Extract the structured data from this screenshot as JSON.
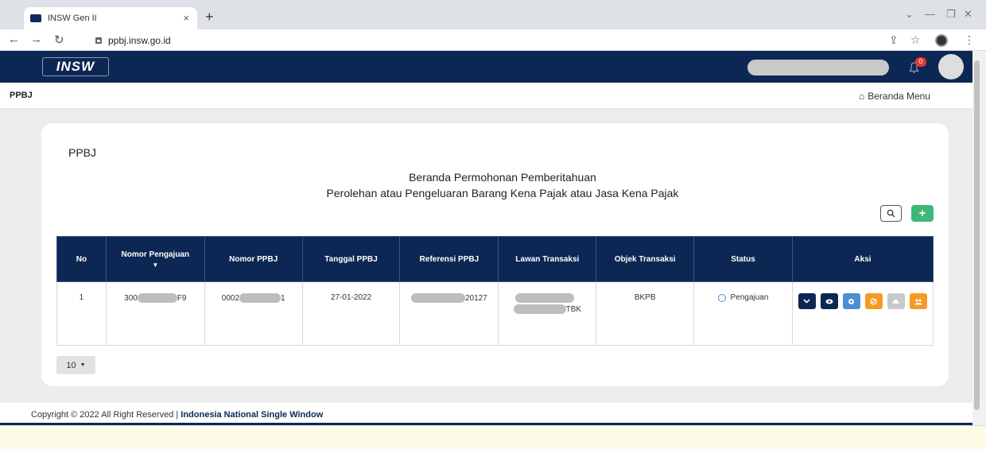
{
  "browser": {
    "tab_title": "INSW Gen II",
    "tab_close": "×",
    "new_tab": "+",
    "url": "ppbj.insw.go.id"
  },
  "header": {
    "logo_text": "INSW",
    "notification_count": "0"
  },
  "subheader": {
    "breadcrumb": "PPBJ",
    "home_link": "Beranda Menu"
  },
  "card": {
    "title": "PPBJ",
    "heading_line1": "Beranda Permohonan Pemberitahuan",
    "heading_line2": "Perolehan atau Pengeluaran Barang Kena Pajak atau Jasa Kena Pajak"
  },
  "table": {
    "headers": [
      "No",
      "Nomor Pengajuan",
      "Nomor PPBJ",
      "Tanggal PPBJ",
      "Referensi PPBJ",
      "Lawan Transaksi",
      "Objek Transaksi",
      "Status",
      "Aksi"
    ],
    "rows": [
      {
        "no": "1",
        "nomor_pengajuan_prefix": "300",
        "nomor_pengajuan_suffix": "F9",
        "nomor_ppbj_prefix": "0002",
        "nomor_ppbj_suffix": "1",
        "tanggal": "27-01-2022",
        "referensi_suffix": "20127",
        "lawan_suffix": "TBK",
        "objek": "BKPB",
        "status": "Pengajuan"
      }
    ],
    "action_colors": [
      "#0d2754",
      "#0d2754",
      "#4a8fd4",
      "#f59a23",
      "#c7c9cc",
      "#f59a23"
    ]
  },
  "pager": {
    "page_size": "10"
  },
  "footer": {
    "copyright": "Copyright © 2022 All Right Reserved | ",
    "org": "Indonesia National Single Window"
  }
}
